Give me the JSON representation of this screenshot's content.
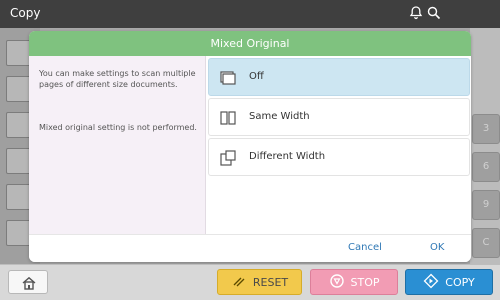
{
  "app": {
    "title": "Copy"
  },
  "header": {
    "icons": [
      "bell-icon",
      "search-icon"
    ]
  },
  "background": {
    "right_keys": [
      "3",
      "6",
      "9",
      "C"
    ]
  },
  "dialog": {
    "title": "Mixed Original",
    "description": "You can make settings to scan multiple pages of different size documents.",
    "status": "Mixed original setting is not performed.",
    "options": [
      {
        "label": "Off",
        "icon": "single-page-icon",
        "selected": true
      },
      {
        "label": "Same Width",
        "icon": "same-width-icon",
        "selected": false
      },
      {
        "label": "Different Width",
        "icon": "different-width-icon",
        "selected": false
      }
    ],
    "cancel_label": "Cancel",
    "ok_label": "OK"
  },
  "bottom": {
    "home_icon": "home-icon",
    "reset_label": "RESET",
    "stop_label": "STOP",
    "copy_label": "COPY"
  },
  "colors": {
    "header": "#3f3f3f",
    "dialog_header": "#7fc27f",
    "selected_option": "#cde6f2",
    "link": "#2f78b5",
    "reset": "#f2c94c",
    "stop": "#f29cb4",
    "copy": "#2a8fd3"
  }
}
